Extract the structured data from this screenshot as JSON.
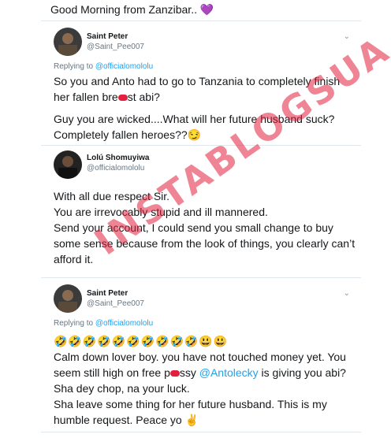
{
  "caption": "Good Morning from Zanzibar.. 💜",
  "tweet1": {
    "name": "Saint Peter",
    "handle": "@Saint_Pee007",
    "replying_prefix": "Replying to ",
    "replying_to": "@officialomololu",
    "line1": "So you and Anto had to go to Tanzania to completely finish",
    "line2a": "her fallen bre",
    "line2b": "st abi?",
    "line3": "Guy you are wicked....What will her future husband suck?",
    "line4": "Completely fallen heroes??😏"
  },
  "tweet2": {
    "name": "Lolú Shomuyiwa",
    "handle": "@officialomololu",
    "line1": "With all due respect Sir.",
    "line2": "You are irrevocably stupid and ill mannered.",
    "line3": "Send your account, I could send you small change to buy",
    "line4": "some sense because from the look of things, you clearly can’t",
    "line5": "afford it."
  },
  "tweet3": {
    "name": "Saint Peter",
    "handle": "@Saint_Pee007",
    "replying_prefix": "Replying to ",
    "replying_to": "@officialomololu",
    "emojis": "🤣🤣🤣🤣🤣🤣🤣🤣🤣🤣😃😃",
    "line1": "Calm down lover boy. you have not touched money yet. You",
    "line2a": "seem still high on free p",
    "line2b": "ssy ",
    "line2_mention": "@Antolecky",
    "line2c": " is giving you abi?",
    "line3": "Sha dey chop, na your luck.",
    "line4": "Sha leave some thing for her future husband. This is my",
    "line5": "humble request. Peace yo ✌"
  },
  "watermark": "INSTABLOGSUA",
  "icons": {
    "chevron": "chevron-down-icon",
    "avatar": "avatar"
  },
  "colors": {
    "link": "#1da1f2",
    "muted": "#657786",
    "watermark": "#e21f3c"
  }
}
